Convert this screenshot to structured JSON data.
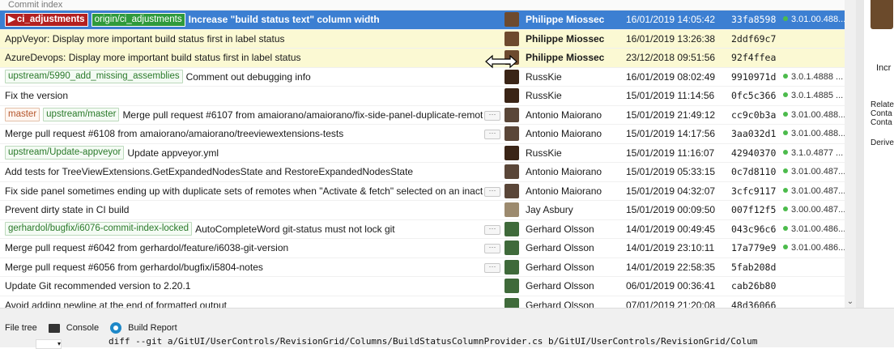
{
  "window": {
    "column_header": "Commit index"
  },
  "commits": [
    {
      "selected": true,
      "highlight": false,
      "tags": [
        {
          "text": "ci_adjustments",
          "kind": "local"
        },
        {
          "text": "origin/ci_adjustments",
          "kind": "remote"
        }
      ],
      "message": "Increase \"build status text\" column width",
      "bold": true,
      "dots": false,
      "avatar": "#6d4a2e",
      "author": "Philippe Miossec",
      "date": "16/01/2019 14:05:42",
      "sha": "33fa8598",
      "build": "3.01.00.488..."
    },
    {
      "selected": false,
      "highlight": true,
      "tags": [],
      "message": "AppVeyor: Display more important build status first in label status",
      "bold": false,
      "dots": false,
      "avatar": "#6d4a2e",
      "author": "Philippe Miossec",
      "author_bold": true,
      "date": "16/01/2019 13:26:38",
      "sha": "2ddf69c7",
      "build": ""
    },
    {
      "selected": false,
      "highlight": true,
      "tags": [],
      "message": "AzureDevops: Display more important build status first in label status",
      "bold": false,
      "dots": false,
      "avatar": "#6d4a2e",
      "author": "Philippe Miossec",
      "author_bold": true,
      "date": "23/12/2018 09:51:56",
      "sha": "92f4ffea",
      "build": ""
    },
    {
      "selected": false,
      "highlight": false,
      "tags": [
        {
          "text": "upstream/5990_add_missing_assemblies",
          "kind": "remote"
        }
      ],
      "message": "Comment out debugging info",
      "bold": false,
      "dots": false,
      "avatar": "#3a2416",
      "author": "RussKie",
      "date": "16/01/2019 08:02:49",
      "sha": "9910971d",
      "build": "3.0.1.4888 ..."
    },
    {
      "selected": false,
      "highlight": false,
      "tags": [],
      "message": "Fix the version",
      "bold": false,
      "dots": false,
      "avatar": "#3a2416",
      "author": "RussKie",
      "date": "15/01/2019 11:14:56",
      "sha": "0fc5c366",
      "build": "3.0.1.4885 ..."
    },
    {
      "selected": false,
      "highlight": false,
      "tags": [
        {
          "text": "master",
          "kind": "local"
        },
        {
          "text": "upstream/master",
          "kind": "remote"
        }
      ],
      "message": "Merge pull request #6107 from amaiorano/amaiorano/fix-side-panel-duplicate-remotes",
      "bold": false,
      "dots": true,
      "avatar": "#5a4638",
      "author": "Antonio Maiorano",
      "date": "15/01/2019 21:49:12",
      "sha": "cc9c0b3a",
      "build": "3.01.00.488..."
    },
    {
      "selected": false,
      "highlight": false,
      "tags": [],
      "message": "Merge pull request #6108 from amaiorano/amaiorano/treeviewextensions-tests",
      "bold": false,
      "dots": true,
      "avatar": "#5a4638",
      "author": "Antonio Maiorano",
      "date": "15/01/2019 14:17:56",
      "sha": "3aa032d1",
      "build": "3.01.00.488..."
    },
    {
      "selected": false,
      "highlight": false,
      "tags": [
        {
          "text": "upstream/Update-appveyor",
          "kind": "remote"
        }
      ],
      "message": "Update appveyor.yml",
      "bold": false,
      "dots": false,
      "avatar": "#3a2416",
      "author": "RussKie",
      "date": "15/01/2019 11:16:07",
      "sha": "42940370",
      "build": "3.1.0.4877 ..."
    },
    {
      "selected": false,
      "highlight": false,
      "tags": [],
      "message": "Add tests for TreeViewExtensions.GetExpandedNodesState and RestoreExpandedNodesState",
      "bold": false,
      "dots": false,
      "avatar": "#5a4638",
      "author": "Antonio Maiorano",
      "date": "15/01/2019 05:33:15",
      "sha": "0c7d8110",
      "build": "3.01.00.487..."
    },
    {
      "selected": false,
      "highlight": false,
      "tags": [],
      "message": "Fix side panel sometimes ending up with duplicate sets of remotes when \"Activate & fetch\" selected on an inactive remote",
      "bold": false,
      "dots": true,
      "avatar": "#5a4638",
      "author": "Antonio Maiorano",
      "date": "15/01/2019 04:32:07",
      "sha": "3cfc9117",
      "build": "3.01.00.487..."
    },
    {
      "selected": false,
      "highlight": false,
      "tags": [],
      "message": "Prevent dirty state in CI build",
      "bold": false,
      "dots": false,
      "avatar": "#9c8a6e",
      "author": "Jay Asbury",
      "date": "15/01/2019 00:09:50",
      "sha": "007f12f5",
      "build": "3.00.00.487..."
    },
    {
      "selected": false,
      "highlight": false,
      "tags": [
        {
          "text": "gerhardol/bugfix/i6076-commit-index-locked",
          "kind": "remote"
        }
      ],
      "message": "AutoCompleteWord git-status must not lock git",
      "bold": false,
      "dots": true,
      "avatar": "#3f6a3a",
      "author": "Gerhard Olsson",
      "date": "14/01/2019 00:49:45",
      "sha": "043c96c6",
      "build": "3.01.00.486..."
    },
    {
      "selected": false,
      "highlight": false,
      "tags": [],
      "message": "Merge pull request #6042 from gerhardol/feature/i6038-git-version",
      "bold": false,
      "dots": true,
      "avatar": "#3f6a3a",
      "author": "Gerhard Olsson",
      "date": "14/01/2019 23:10:11",
      "sha": "17a779e9",
      "build": "3.01.00.486..."
    },
    {
      "selected": false,
      "highlight": false,
      "tags": [],
      "message": "Merge pull request #6056 from gerhardol/bugfix/i5804-notes",
      "bold": false,
      "dots": true,
      "avatar": "#3f6a3a",
      "author": "Gerhard Olsson",
      "date": "14/01/2019 22:58:35",
      "sha": "5fab208d",
      "build": ""
    },
    {
      "selected": false,
      "highlight": false,
      "tags": [],
      "message": "Update Git recommended version to 2.20.1",
      "bold": false,
      "dots": false,
      "avatar": "#3f6a3a",
      "author": "Gerhard Olsson",
      "date": "06/01/2019 00:36:41",
      "sha": "cab26b80",
      "build": ""
    },
    {
      "selected": false,
      "highlight": false,
      "tags": [],
      "message": "Avoid adding newline at the end of formatted output",
      "bold": false,
      "dots": false,
      "avatar": "#3f6a3a",
      "author": "Gerhard Olsson",
      "date": "07/01/2019 21:20:08",
      "sha": "48d36066",
      "build": ""
    }
  ],
  "right_panel": {
    "text1": "Incr",
    "lines": [
      "Relate",
      "Conta",
      "Conta",
      "",
      "Derive"
    ]
  },
  "bottom": {
    "tabs": {
      "file_tree": "File tree",
      "console": "Console",
      "build_report": "Build Report"
    },
    "diff_line": "diff --git a/GitUI/UserControls/RevisionGrid/Columns/BuildStatusColumnProvider.cs b/GitUI/UserControls/RevisionGrid/Colum"
  },
  "colors": {
    "selection": "#3c7fd2",
    "highlight": "#fbf9d3",
    "build_success": "#4cbb4c"
  }
}
